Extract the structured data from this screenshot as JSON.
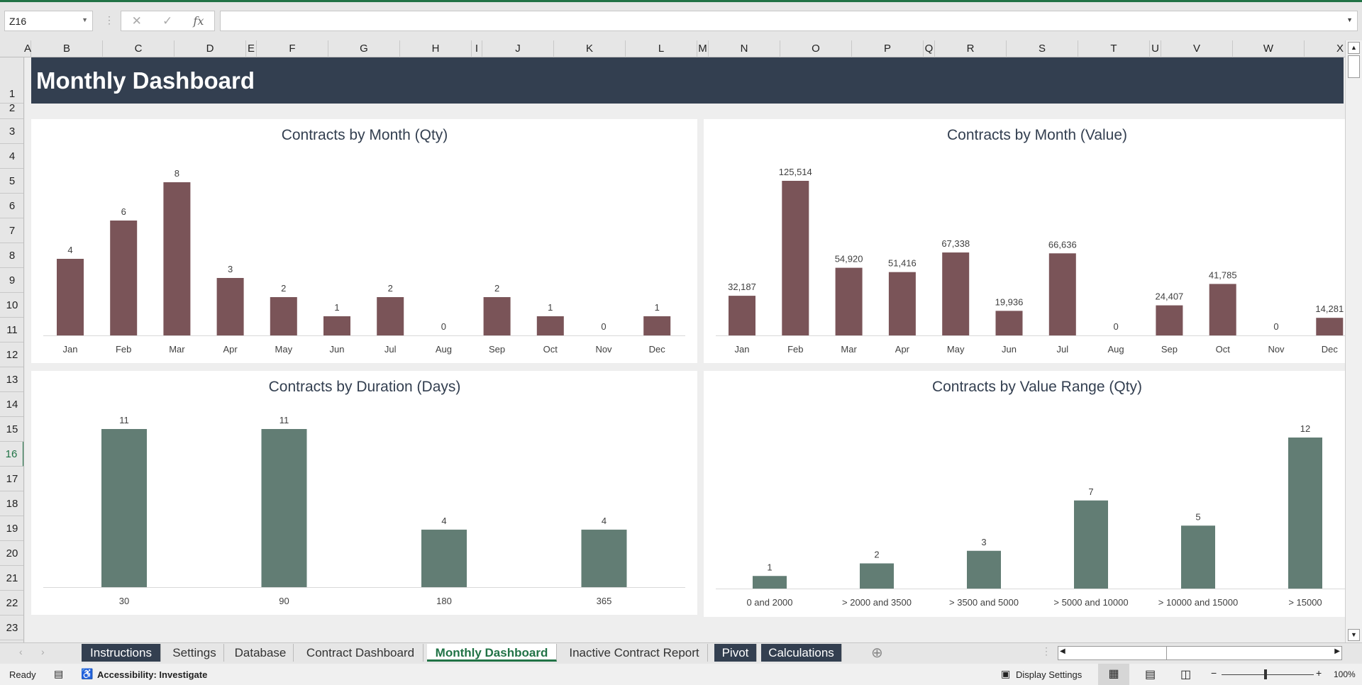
{
  "app": {
    "name_box": "Z16",
    "formula": "",
    "accent": "#217346"
  },
  "columns": [
    "A",
    "B",
    "C",
    "D",
    "E",
    "F",
    "G",
    "H",
    "I",
    "J",
    "K",
    "L",
    "M",
    "N",
    "O",
    "P",
    "Q",
    "R",
    "S",
    "T",
    "U",
    "V",
    "W",
    "X"
  ],
  "rows": [
    "1",
    "2",
    "3",
    "4",
    "5",
    "6",
    "7",
    "8",
    "9",
    "10",
    "11",
    "12",
    "13",
    "14",
    "15",
    "16",
    "17",
    "18",
    "19",
    "20",
    "21",
    "22",
    "23"
  ],
  "selected_row": "16",
  "sheet": {
    "title": "Monthly Dashboard",
    "title_bg": "#333f50"
  },
  "chart_data": [
    {
      "type": "bar",
      "title": "Contracts by Month (Qty)",
      "categories": [
        "Jan",
        "Feb",
        "Mar",
        "Apr",
        "May",
        "Jun",
        "Jul",
        "Aug",
        "Sep",
        "Oct",
        "Nov",
        "Dec"
      ],
      "values": [
        4,
        6,
        8,
        3,
        2,
        1,
        2,
        0,
        2,
        1,
        0,
        1
      ],
      "labels": [
        "4",
        "6",
        "8",
        "3",
        "2",
        "1",
        "2",
        "0",
        "2",
        "1",
        "0",
        "1"
      ],
      "color": "#7a5458",
      "grid": false,
      "legend": "none"
    },
    {
      "type": "bar",
      "title": "Contracts by Month (Value)",
      "categories": [
        "Jan",
        "Feb",
        "Mar",
        "Apr",
        "May",
        "Jun",
        "Jul",
        "Aug",
        "Sep",
        "Oct",
        "Nov",
        "Dec"
      ],
      "values": [
        32187,
        125514,
        54920,
        51416,
        67338,
        19936,
        66636,
        0,
        24407,
        41785,
        0,
        14281
      ],
      "labels": [
        "32,187",
        "125,514",
        "54,920",
        "51,416",
        "67,338",
        "19,936",
        "66,636",
        "0",
        "24,407",
        "41,785",
        "0",
        "14,281"
      ],
      "color": "#7a5458",
      "grid": false,
      "legend": "none"
    },
    {
      "type": "bar",
      "title": "Contracts by Duration (Days)",
      "categories": [
        "30",
        "90",
        "180",
        "365"
      ],
      "values": [
        11,
        11,
        4,
        4
      ],
      "labels": [
        "11",
        "11",
        "4",
        "4"
      ],
      "color": "#627d74",
      "grid": false,
      "legend": "none"
    },
    {
      "type": "bar",
      "title": "Contracts by Value Range (Qty)",
      "categories": [
        "0 and 2000",
        "> 2000 and 3500",
        "> 3500 and 5000",
        "> 5000 and 10000",
        "> 10000 and 15000",
        "> 15000"
      ],
      "values": [
        1,
        2,
        3,
        7,
        5,
        12
      ],
      "labels": [
        "1",
        "2",
        "3",
        "7",
        "5",
        "12"
      ],
      "color": "#627d74",
      "grid": false,
      "legend": "none"
    }
  ],
  "tabs": [
    {
      "label": "Instructions",
      "style": "dark"
    },
    {
      "label": "Settings",
      "style": "normal"
    },
    {
      "label": "Database",
      "style": "normal"
    },
    {
      "label": "Contract Dashboard",
      "style": "normal"
    },
    {
      "label": "Monthly Dashboard",
      "style": "active"
    },
    {
      "label": "Inactive Contract Report",
      "style": "normal"
    },
    {
      "label": "Pivot",
      "style": "dark"
    },
    {
      "label": "Calculations",
      "style": "dark"
    }
  ],
  "status": {
    "ready": "Ready",
    "accessibility": "Accessibility: Investigate",
    "display_settings": "Display Settings",
    "zoom": "100%",
    "zoom_level_percent": 100
  }
}
